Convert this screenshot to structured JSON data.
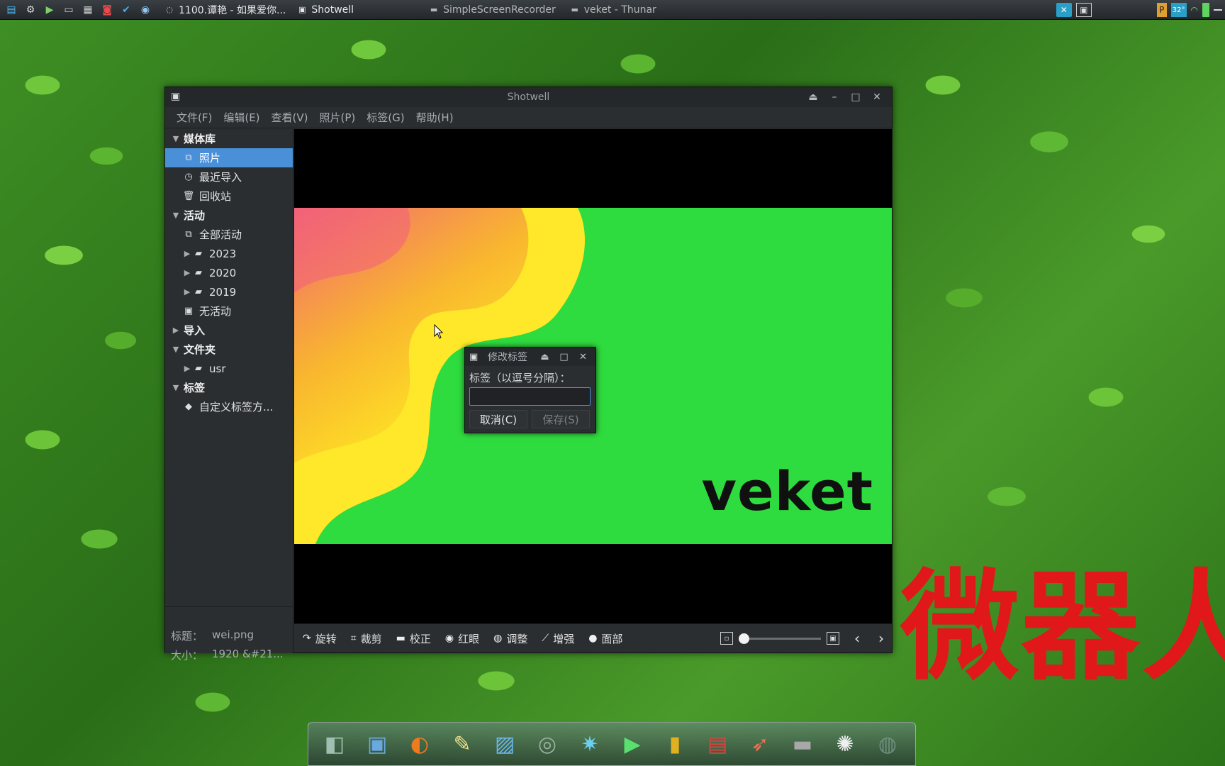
{
  "top_panel": {
    "launchers": [
      {
        "name": "system-monitor-icon",
        "glyph": "▤",
        "color": "#4ab6e8"
      },
      {
        "name": "settings-gear-icon",
        "glyph": "⚙",
        "color": "#dddddd"
      },
      {
        "name": "media-play-icon",
        "glyph": "▶",
        "color": "#7fd06a"
      },
      {
        "name": "terminal-icon",
        "glyph": "▭",
        "color": "#cccccc"
      },
      {
        "name": "printer-icon",
        "glyph": "▦",
        "color": "#cccccc"
      },
      {
        "name": "screenshot-icon",
        "glyph": "◙",
        "color": "#e84a4a"
      },
      {
        "name": "download-icon",
        "glyph": "✔",
        "color": "#4aa8e8"
      },
      {
        "name": "network-icon",
        "glyph": "◉",
        "color": "#8fc8f0"
      }
    ],
    "tasks": [
      {
        "name": "task-music-player",
        "icon": "◌",
        "label": "1100.谭艳 - 如果爱你...",
        "dim": false
      },
      {
        "name": "task-shotwell",
        "icon": "▣",
        "label": "Shotwell",
        "dim": false
      },
      {
        "name": "task-screen-recorder",
        "icon": "▬",
        "label": "SimpleScreenRecorder",
        "dim": true
      },
      {
        "name": "task-thunar",
        "icon": "▬",
        "label": "veket - Thunar",
        "dim": true
      }
    ],
    "tray": {
      "temp": "32°",
      "items": [
        "note-icon",
        "temperature-icon",
        "wifi-icon",
        "battery-icon"
      ]
    }
  },
  "shotwell": {
    "title": "Shotwell",
    "menu": [
      "文件(F)",
      "编辑(E)",
      "查看(V)",
      "照片(P)",
      "标签(G)",
      "帮助(H)"
    ],
    "sidebar": [
      {
        "name": "tree-library",
        "type": "head",
        "label": "媒体库",
        "expander": "▼"
      },
      {
        "name": "tree-photos",
        "type": "item",
        "label": "照片",
        "icon": "⧉",
        "selected": true
      },
      {
        "name": "tree-last-import",
        "type": "item",
        "label": "最近导入",
        "icon": "◷"
      },
      {
        "name": "tree-trash",
        "type": "item",
        "label": "回收站",
        "icon": "🗑"
      },
      {
        "name": "tree-events",
        "type": "head",
        "label": "活动",
        "expander": "▼"
      },
      {
        "name": "tree-all-events",
        "type": "item",
        "label": "全部活动",
        "icon": "⧉"
      },
      {
        "name": "tree-2023",
        "type": "folder",
        "label": "2023",
        "icon": "▰",
        "expander": "▶"
      },
      {
        "name": "tree-2020",
        "type": "folder",
        "label": "2020",
        "icon": "▰",
        "expander": "▶"
      },
      {
        "name": "tree-2019",
        "type": "folder",
        "label": "2019",
        "icon": "▰",
        "expander": "▶"
      },
      {
        "name": "tree-no-event",
        "type": "item",
        "label": "无活动",
        "icon": "▣"
      },
      {
        "name": "tree-import",
        "type": "head",
        "label": "导入",
        "expander": "▶"
      },
      {
        "name": "tree-folders",
        "type": "head",
        "label": "文件夹",
        "expander": "▼"
      },
      {
        "name": "tree-usr",
        "type": "folder",
        "label": "usr",
        "icon": "▰",
        "expander": "▶"
      },
      {
        "name": "tree-tags",
        "type": "head",
        "label": "标签",
        "expander": "▼"
      },
      {
        "name": "tree-custom-tags",
        "type": "item",
        "label": "自定义标签方...",
        "icon": "◆"
      }
    ],
    "info": {
      "title_key": "标题：",
      "title_value": "wei.png",
      "size_key": "大小：",
      "size_value": "1920 &#21..."
    },
    "photo_text": "veket",
    "toolbar": [
      {
        "name": "rotate-button",
        "icon": "↷",
        "label": "旋转"
      },
      {
        "name": "crop-button",
        "icon": "⌗",
        "label": "裁剪"
      },
      {
        "name": "straighten-button",
        "icon": "▬",
        "label": "校正"
      },
      {
        "name": "redeye-button",
        "icon": "◉",
        "label": "红眼"
      },
      {
        "name": "adjust-button",
        "icon": "◍",
        "label": "调整"
      },
      {
        "name": "enhance-button",
        "icon": "⟋",
        "label": "增强"
      },
      {
        "name": "faces-button",
        "icon": "●",
        "label": "面部"
      }
    ]
  },
  "dialog": {
    "title": "修改标签",
    "label": "标签（以逗号分隔）：",
    "input_value": "",
    "cancel": "取消(C)",
    "save": "保存(S)"
  },
  "desktop_text": "微器人",
  "dock": [
    {
      "name": "dock-desktop-icon",
      "glyph": "◧",
      "color": "#9fc0b0"
    },
    {
      "name": "dock-computer-icon",
      "glyph": "▣",
      "color": "#6aa8e0"
    },
    {
      "name": "dock-firefox-icon",
      "glyph": "◐",
      "color": "#f07a20"
    },
    {
      "name": "dock-editor-icon",
      "glyph": "✎",
      "color": "#f0e08a"
    },
    {
      "name": "dock-image-viewer-icon",
      "glyph": "▨",
      "color": "#6ab8f0"
    },
    {
      "name": "dock-disc-icon",
      "glyph": "◎",
      "color": "#9ab0a0"
    },
    {
      "name": "dock-network-icon",
      "glyph": "✷",
      "color": "#6ad0f0"
    },
    {
      "name": "dock-media-player-icon",
      "glyph": "▶",
      "color": "#5ae070"
    },
    {
      "name": "dock-contacts-icon",
      "glyph": "▮",
      "color": "#e0b020"
    },
    {
      "name": "dock-presentation-icon",
      "glyph": "▤",
      "color": "#e04040"
    },
    {
      "name": "dock-rocket-icon",
      "glyph": "➶",
      "color": "#f07050"
    },
    {
      "name": "dock-drive-icon",
      "glyph": "▬",
      "color": "#a8a8a8"
    },
    {
      "name": "dock-settings-icon",
      "glyph": "✺",
      "color": "#f0f0f0"
    },
    {
      "name": "dock-globe-icon",
      "glyph": "◍",
      "color": "#709080"
    }
  ]
}
